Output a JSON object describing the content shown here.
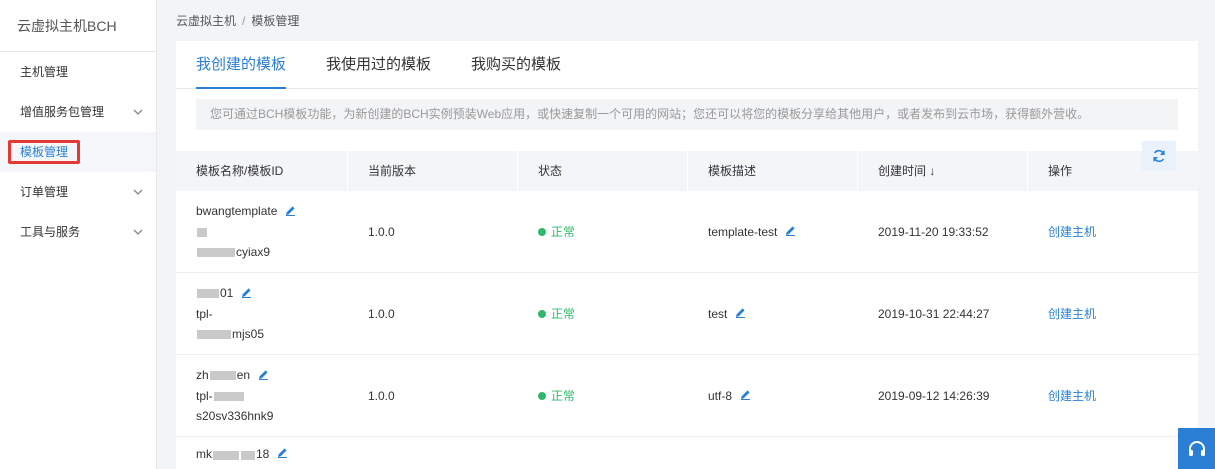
{
  "sidebar": {
    "title": "云虚拟主机BCH",
    "items": [
      {
        "label": "主机管理",
        "has_children": false
      },
      {
        "label": "增值服务包管理",
        "has_children": true
      },
      {
        "label": "模板管理",
        "has_children": false,
        "active": true
      },
      {
        "label": "订单管理",
        "has_children": true
      },
      {
        "label": "工具与服务",
        "has_children": true
      }
    ]
  },
  "breadcrumb": {
    "root": "云虚拟主机",
    "sep": "/",
    "current": "模板管理"
  },
  "tabs": [
    {
      "label": "我创建的模板",
      "active": true
    },
    {
      "label": "我使用过的模板",
      "active": false
    },
    {
      "label": "我购买的模板",
      "active": false
    }
  ],
  "notice": "您可通过BCH模板功能，为新创建的BCH实例预装Web应用，或快速复制一个可用的网站；您还可以将您的模板分享给其他用户，或者发布到云市场，获得额外营收。",
  "table": {
    "headers": [
      "模板名称/模板ID",
      "当前版本",
      "状态",
      "模板描述",
      "创建时间 ↓",
      "操作"
    ],
    "rows": [
      {
        "name_line1": "bwangtemplate",
        "name_line2": "",
        "name_line3": "cyiax9",
        "version": "1.0.0",
        "status": "正常",
        "desc": "template-test",
        "created": "2019-11-20 19:33:52",
        "action": "创建主机"
      },
      {
        "name_line1": "01",
        "name_line2": "tpl-",
        "name_line3": "mjs05",
        "version": "1.0.0",
        "status": "正常",
        "desc": "test",
        "created": "2019-10-31 22:44:27",
        "action": "创建主机"
      },
      {
        "name_line1": "zh",
        "name_line1b": "en",
        "name_line2": "tpl-",
        "name_line3": "s20sv336hnk9",
        "version": "1.0.0",
        "status": "正常",
        "desc": "utf-8",
        "created": "2019-09-12 14:26:39",
        "action": "创建主机"
      },
      {
        "name_line1": "mk",
        "name_line1b": "18"
      }
    ]
  },
  "colors": {
    "accent": "#2a7fd4",
    "status_ok": "#2fb86b",
    "highlight": "#e53935"
  }
}
